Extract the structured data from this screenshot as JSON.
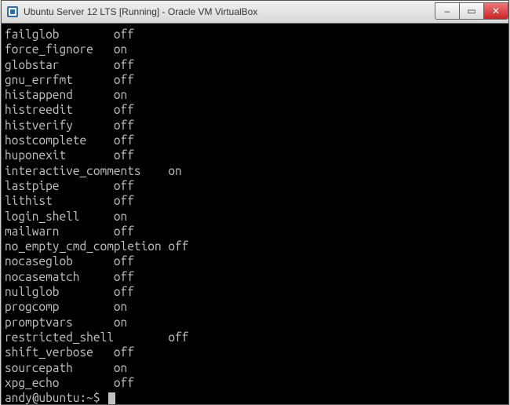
{
  "window": {
    "title": "Ubuntu Server 12 LTS [Running] - Oracle VM VirtualBox",
    "icon": "virtualbox-icon",
    "buttons": {
      "minimize": "–",
      "maximize": "▭",
      "close": "✕"
    }
  },
  "terminal": {
    "options": [
      {
        "name": "failglob",
        "value": "off"
      },
      {
        "name": "force_fignore",
        "value": "on"
      },
      {
        "name": "globstar",
        "value": "off"
      },
      {
        "name": "gnu_errfmt",
        "value": "off"
      },
      {
        "name": "histappend",
        "value": "on"
      },
      {
        "name": "histreedit",
        "value": "off"
      },
      {
        "name": "histverify",
        "value": "off"
      },
      {
        "name": "hostcomplete",
        "value": "off"
      },
      {
        "name": "huponexit",
        "value": "off"
      },
      {
        "name": "interactive_comments",
        "value": "on"
      },
      {
        "name": "lastpipe",
        "value": "off"
      },
      {
        "name": "lithist",
        "value": "off"
      },
      {
        "name": "login_shell",
        "value": "on"
      },
      {
        "name": "mailwarn",
        "value": "off"
      },
      {
        "name": "no_empty_cmd_completion",
        "value": "off"
      },
      {
        "name": "nocaseglob",
        "value": "off"
      },
      {
        "name": "nocasematch",
        "value": "off"
      },
      {
        "name": "nullglob",
        "value": "off"
      },
      {
        "name": "progcomp",
        "value": "on"
      },
      {
        "name": "promptvars",
        "value": "on"
      },
      {
        "name": "restricted_shell",
        "value": "off"
      },
      {
        "name": "shift_verbose",
        "value": "off"
      },
      {
        "name": "sourcepath",
        "value": "on"
      },
      {
        "name": "xpg_echo",
        "value": "off"
      }
    ],
    "prompt": "andy@ubuntu:~$ "
  }
}
